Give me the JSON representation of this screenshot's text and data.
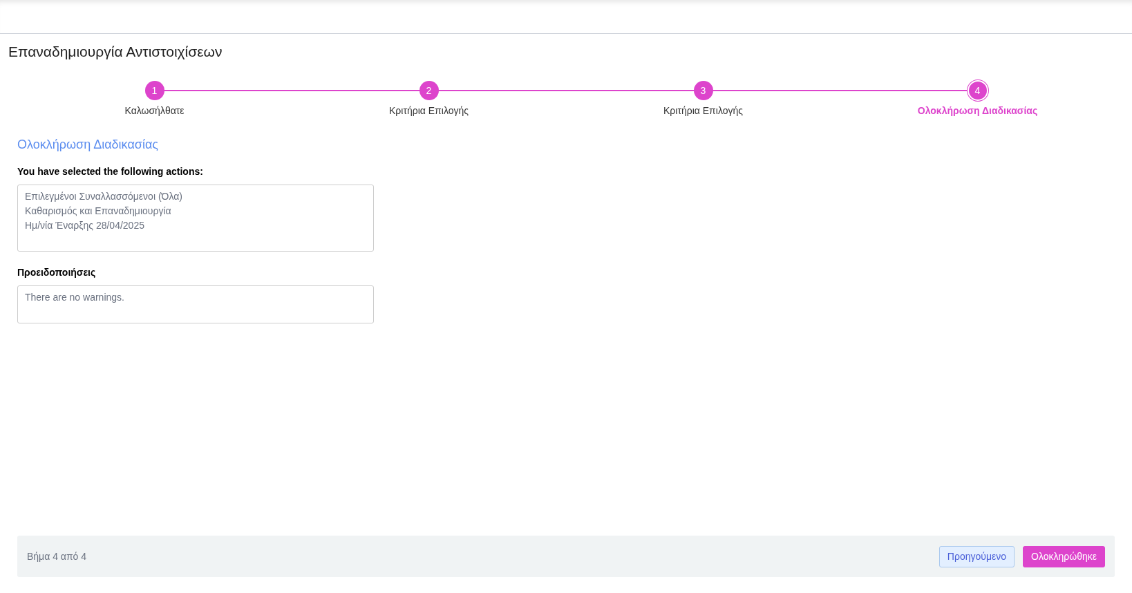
{
  "page_title": "Επαναδημιουργία Αντιστοιχίσεων",
  "steps": [
    {
      "number": "1",
      "label": "Καλωσήλθατε",
      "selected": false
    },
    {
      "number": "2",
      "label": "Κριτήρια Επιλογής",
      "selected": false
    },
    {
      "number": "3",
      "label": "Κριτήρια Επιλογής",
      "selected": false
    },
    {
      "number": "4",
      "label": "Ολοκλήρωση Διαδικασίας",
      "selected": true
    }
  ],
  "section_title": "Ολοκλήρωση Διαδικασίας",
  "actions": {
    "label": "You have selected the following actions:",
    "lines": [
      "Επιλεγμένοι Συναλλασσόμενοι (Όλα)",
      "Καθαρισμός και Επαναδημιουργία",
      "Ημ/νία Έναρξης 28/04/2025"
    ]
  },
  "warnings": {
    "label": "Προειδοποιήσεις",
    "lines": [
      "There are no warnings."
    ]
  },
  "footer": {
    "step_text": "Βήμα 4 από 4",
    "previous_button": "Προηγούμενο",
    "finish_button": "Ολοκληρώθηκε"
  }
}
